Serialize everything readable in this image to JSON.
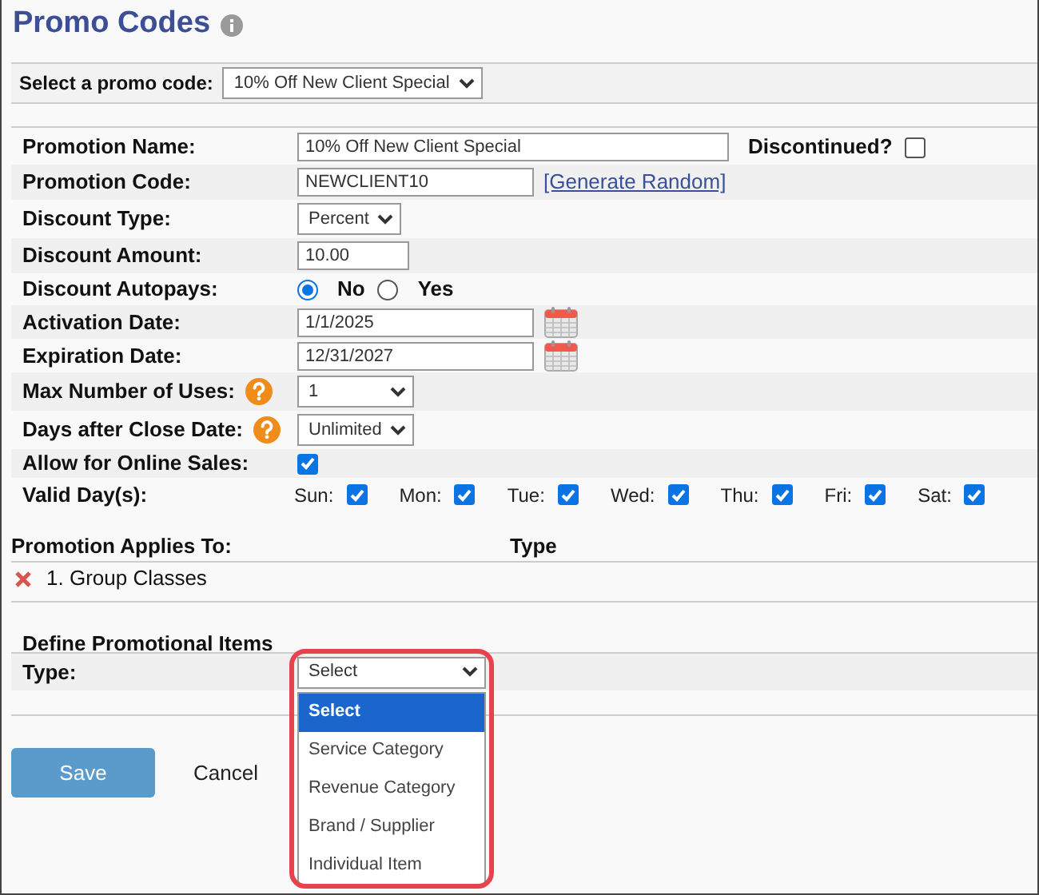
{
  "title": "Promo Codes",
  "promo_select": {
    "label": "Select a promo code:",
    "value": "10% Off New Client Special"
  },
  "rows": [
    {
      "kind": "text",
      "label": "Promotion Name:",
      "value": "10% Off New Client Special",
      "discontinued": {
        "label": "Discontinued?",
        "checked": false
      }
    },
    {
      "kind": "text",
      "label": "Promotion Code:",
      "value": "NEWCLIENT10",
      "link": "[Generate Random]"
    },
    {
      "kind": "select",
      "label": "Discount Type:",
      "value": "Percent"
    },
    {
      "kind": "text",
      "label": "Discount Amount:",
      "value": "10.00"
    },
    {
      "kind": "radio",
      "label": "Discount Autopays:",
      "options": [
        {
          "label": "No",
          "selected": true
        },
        {
          "label": "Yes",
          "selected": false
        }
      ]
    },
    {
      "kind": "date",
      "label": "Activation Date:",
      "value": "1/1/2025"
    },
    {
      "kind": "date",
      "label": "Expiration Date:",
      "value": "12/31/2027"
    },
    {
      "kind": "select",
      "label": "Max Number of Uses:",
      "value": "1",
      "help": true
    },
    {
      "kind": "select",
      "label": "Days after Close Date:",
      "value": "Unlimited",
      "help": true
    },
    {
      "kind": "checkbox",
      "label": "Allow for Online Sales:",
      "checked": true
    },
    {
      "kind": "days",
      "label": "Valid Day(s):",
      "days": [
        {
          "label": "Sun:",
          "checked": true
        },
        {
          "label": "Mon:",
          "checked": true
        },
        {
          "label": "Tue:",
          "checked": true
        },
        {
          "label": "Wed:",
          "checked": true
        },
        {
          "label": "Thu:",
          "checked": true
        },
        {
          "label": "Fri:",
          "checked": true
        },
        {
          "label": "Sat:",
          "checked": true
        }
      ]
    }
  ],
  "applies": {
    "heading": "Promotion Applies To:",
    "type_heading": "Type",
    "items": [
      {
        "name": "1. Group Classes"
      }
    ]
  },
  "define": {
    "heading": "Define Promotional Items",
    "type_label": "Type:",
    "select_value": "Select",
    "expanded": true,
    "options": [
      {
        "label": "Select",
        "selected": true
      },
      {
        "label": "Service Category",
        "selected": false
      },
      {
        "label": "Revenue Category",
        "selected": false
      },
      {
        "label": "Brand / Supplier",
        "selected": false
      },
      {
        "label": "Individual Item",
        "selected": false
      }
    ]
  },
  "buttons": {
    "save": "Save",
    "cancel": "Cancel"
  }
}
